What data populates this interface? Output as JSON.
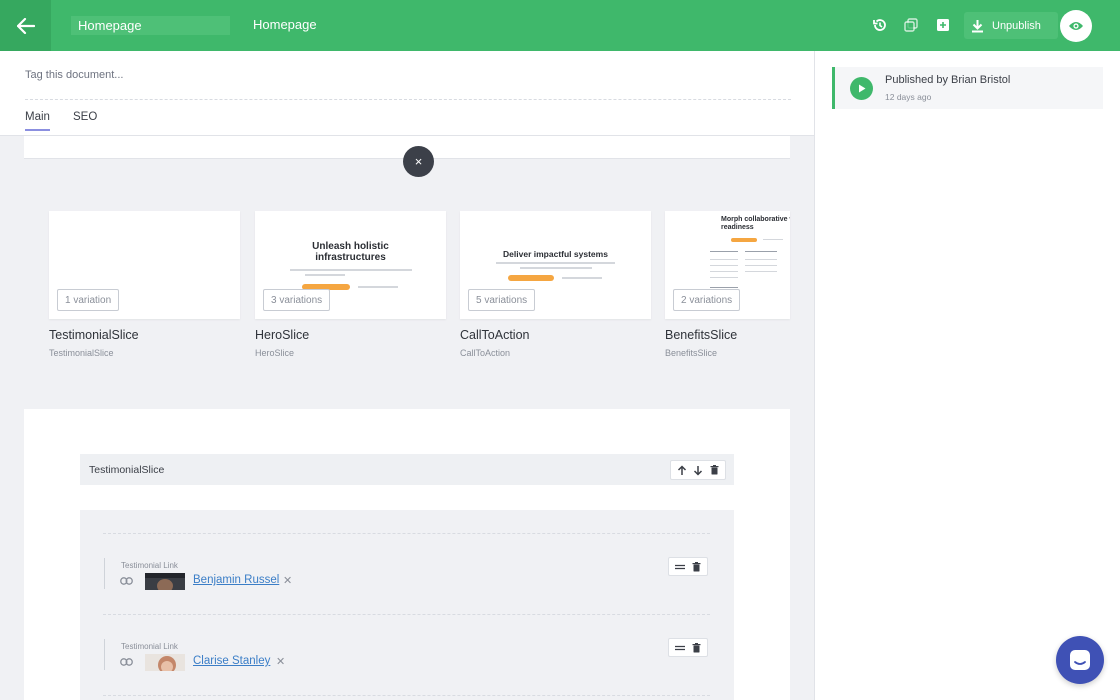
{
  "topbar": {
    "title_input_value": "Homepage",
    "title_text": "Homepage",
    "unpublish_label": "Unpublish",
    "colors": {
      "bar": "#3fb86b",
      "accent": "#4ec077"
    }
  },
  "document": {
    "tag_placeholder": "Tag this document...",
    "tabs": [
      {
        "label": "Main",
        "active": true
      },
      {
        "label": "SEO",
        "active": false
      }
    ]
  },
  "slice_picker": {
    "close_symbol": "×",
    "slices": [
      {
        "name": "TestimonialSlice",
        "sub": "TestimonialSlice",
        "variations": "1 variation"
      },
      {
        "name": "HeroSlice",
        "sub": "HeroSlice",
        "variations": "3 variations",
        "thumb_title": "Unleash holistic infrastructures"
      },
      {
        "name": "CallToAction",
        "sub": "CallToAction",
        "variations": "5 variations",
        "thumb_title": "Deliver impactful systems"
      },
      {
        "name": "BenefitsSlice",
        "sub": "BenefitsSlice",
        "variations": "2 variations",
        "thumb_title": "Morph collaborative w readiness"
      }
    ]
  },
  "slice_editor": {
    "header_label": "TestimonialSlice",
    "fields": [
      {
        "label": "Testimonial Link",
        "link_text": "Benjamin Russel",
        "remove_symbol": "✕"
      },
      {
        "label": "Testimonial Link",
        "link_text": "Clarise Stanley",
        "remove_symbol": "✕"
      }
    ]
  },
  "status": {
    "title": "Published by Brian Bristol",
    "time": "12 days ago",
    "color": "#3fb86b"
  },
  "icons": [
    "arrow-left-icon",
    "history-icon",
    "duplicate-icon",
    "archive-icon",
    "download-icon",
    "eye-icon",
    "close-icon",
    "arrow-up-icon",
    "arrow-down-icon",
    "trash-icon",
    "link-icon",
    "drag-handle-icon",
    "play-icon",
    "chat-icon"
  ]
}
